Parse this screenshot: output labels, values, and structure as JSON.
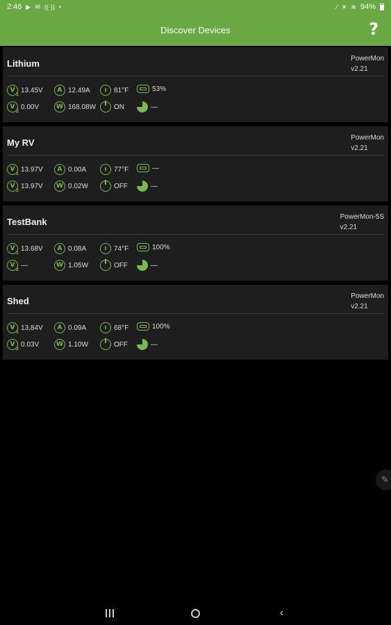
{
  "status_bar": {
    "time": "2:46",
    "battery_text": "94%"
  },
  "app_bar": {
    "title": "Discover Devices",
    "help_label": "?"
  },
  "colors": {
    "accent": "#6aa844",
    "icon": "#7bb84e",
    "card_bg": "#1e1e1e"
  },
  "devices": [
    {
      "name": "Lithium",
      "model": "PowerMon",
      "version": "v2.21",
      "v1": "13.45V",
      "a": "12.49A",
      "temp": "81°F",
      "soc": "53%",
      "v2": "0.00V",
      "w": "168.08W",
      "power": "ON",
      "remaining": "—"
    },
    {
      "name": "My RV",
      "model": "PowerMon",
      "version": "v2.21",
      "v1": "13.97V",
      "a": "0.00A",
      "temp": "77°F",
      "soc": "—",
      "v2": "13.97V",
      "w": "0.02W",
      "power": "OFF",
      "remaining": "—"
    },
    {
      "name": "TestBank",
      "model": "PowerMon-5S",
      "version": "v2.21",
      "v1": "13.68V",
      "a": "0.08A",
      "temp": "74°F",
      "soc": "100%",
      "v2": "—",
      "w": "1.05W",
      "power": "OFF",
      "remaining": "—"
    },
    {
      "name": "Shed",
      "model": "PowerMon",
      "version": "v2.21",
      "v1": "13.84V",
      "a": "0.09A",
      "temp": "68°F",
      "soc": "100%",
      "v2": "0.03V",
      "w": "1.10W",
      "power": "OFF",
      "remaining": "—"
    }
  ],
  "icons": {
    "v1": "voltage-1-icon",
    "v2": "voltage-2-icon",
    "a": "current-icon",
    "w": "power-watts-icon",
    "temp": "thermometer-icon",
    "soc": "battery-icon",
    "power": "power-icon",
    "remaining": "pie-chart-icon",
    "edge": "pencil-icon"
  },
  "nav": {
    "recent": "recent-apps",
    "home": "home",
    "back": "back"
  }
}
